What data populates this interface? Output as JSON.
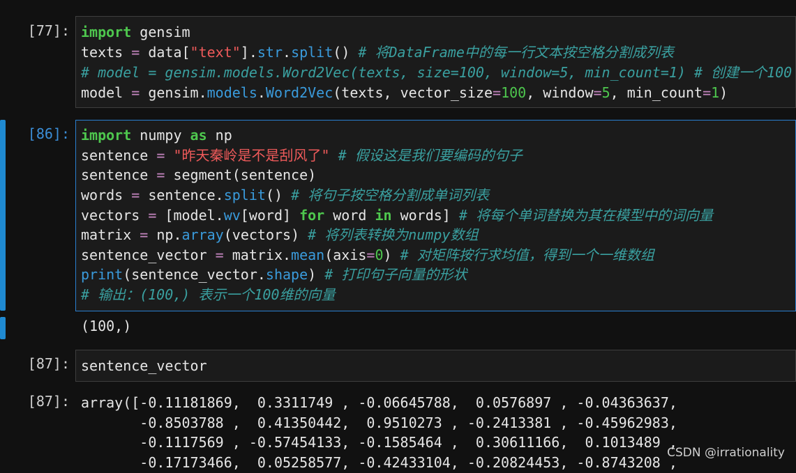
{
  "cells": [
    {
      "prompt": "[77]:",
      "lines": [
        [
          [
            "kw",
            "import"
          ],
          [
            "t",
            " gensim"
          ]
        ],
        [
          [
            "t",
            "texts "
          ],
          [
            "op",
            "="
          ],
          [
            "t",
            " data["
          ],
          [
            "str",
            "\"text\""
          ],
          [
            "t",
            "]."
          ],
          [
            "fn",
            "str"
          ],
          [
            "t",
            "."
          ],
          [
            "fn",
            "split"
          ],
          [
            "t",
            "() "
          ],
          [
            "cm",
            "# 将DataFrame中的每一行文本按空格分割成列表"
          ]
        ],
        [
          [
            "cm",
            "# model = gensim.models.Word2Vec(texts, size=100, window=5, min_count=1) # 创建一个100"
          ]
        ],
        [
          [
            "t",
            "model "
          ],
          [
            "op",
            "="
          ],
          [
            "t",
            " gensim."
          ],
          [
            "fn",
            "models"
          ],
          [
            "t",
            "."
          ],
          [
            "fn",
            "Word2Vec"
          ],
          [
            "t",
            "(texts, vector_size"
          ],
          [
            "op",
            "="
          ],
          [
            "num",
            "100"
          ],
          [
            "t",
            ", window"
          ],
          [
            "op",
            "="
          ],
          [
            "num",
            "5"
          ],
          [
            "t",
            ", min_count"
          ],
          [
            "op",
            "="
          ],
          [
            "num",
            "1"
          ],
          [
            "t",
            ")"
          ]
        ]
      ]
    },
    {
      "prompt": "[86]:",
      "lines": [
        [
          [
            "kw",
            "import"
          ],
          [
            "t",
            " numpy "
          ],
          [
            "kw",
            "as"
          ],
          [
            "t",
            " np"
          ]
        ],
        [
          [
            "t",
            "sentence "
          ],
          [
            "op",
            "="
          ],
          [
            "t",
            " "
          ],
          [
            "str",
            "\"昨天秦岭是不是刮风了\""
          ],
          [
            "t",
            " "
          ],
          [
            "cm",
            "# 假设这是我们要编码的句子"
          ]
        ],
        [
          [
            "t",
            "sentence "
          ],
          [
            "op",
            "="
          ],
          [
            "t",
            " segment(sentence)"
          ]
        ],
        [
          [
            "t",
            "words "
          ],
          [
            "op",
            "="
          ],
          [
            "t",
            " sentence."
          ],
          [
            "fn",
            "split"
          ],
          [
            "t",
            "() "
          ],
          [
            "cm",
            "# 将句子按空格分割成单词列表"
          ]
        ],
        [
          [
            "t",
            "vectors "
          ],
          [
            "op",
            "="
          ],
          [
            "t",
            " [model."
          ],
          [
            "fn",
            "wv"
          ],
          [
            "t",
            "[word] "
          ],
          [
            "kw",
            "for"
          ],
          [
            "t",
            " word "
          ],
          [
            "kw",
            "in"
          ],
          [
            "t",
            " words] "
          ],
          [
            "cm",
            "# 将每个单词替换为其在模型中的词向量"
          ]
        ],
        [
          [
            "t",
            "matrix "
          ],
          [
            "op",
            "="
          ],
          [
            "t",
            " np."
          ],
          [
            "fn",
            "array"
          ],
          [
            "t",
            "(vectors) "
          ],
          [
            "cm",
            "# 将列表转换为numpy数组"
          ]
        ],
        [
          [
            "t",
            "sentence_vector "
          ],
          [
            "op",
            "="
          ],
          [
            "t",
            " matrix."
          ],
          [
            "fn",
            "mean"
          ],
          [
            "t",
            "(axis"
          ],
          [
            "op",
            "="
          ],
          [
            "num",
            "0"
          ],
          [
            "t",
            ") "
          ],
          [
            "cm",
            "# 对矩阵按行求均值，得到一个一维数组"
          ]
        ],
        [
          [
            "fn",
            "print"
          ],
          [
            "t",
            "(sentence_vector."
          ],
          [
            "fn",
            "shape"
          ],
          [
            "t",
            ") "
          ],
          [
            "cm",
            "# 打印句子向量的形状"
          ]
        ],
        [
          [
            "cm",
            "# 输出：(100,) 表示一个100维的向量"
          ]
        ]
      ],
      "output": "(100,)"
    },
    {
      "prompt": "[87]:",
      "lines": [
        [
          [
            "t",
            "sentence_vector"
          ]
        ]
      ],
      "out_prompt": "[87]:",
      "output_lines": [
        "array([-0.11181869,  0.3311749 , -0.06645788,  0.0576897 , -0.04363637,",
        "       -0.8503788 ,  0.41350442,  0.9510273 , -0.2413381 , -0.45962983,",
        "       -0.1117569 , -0.57454133, -0.1585464 ,  0.30611166,  0.1013489 ,",
        "       -0.17173466,  0.05258577, -0.42433104, -0.20824453, -0.8743208 ,"
      ]
    }
  ],
  "watermark": "CSDN @irrationality"
}
